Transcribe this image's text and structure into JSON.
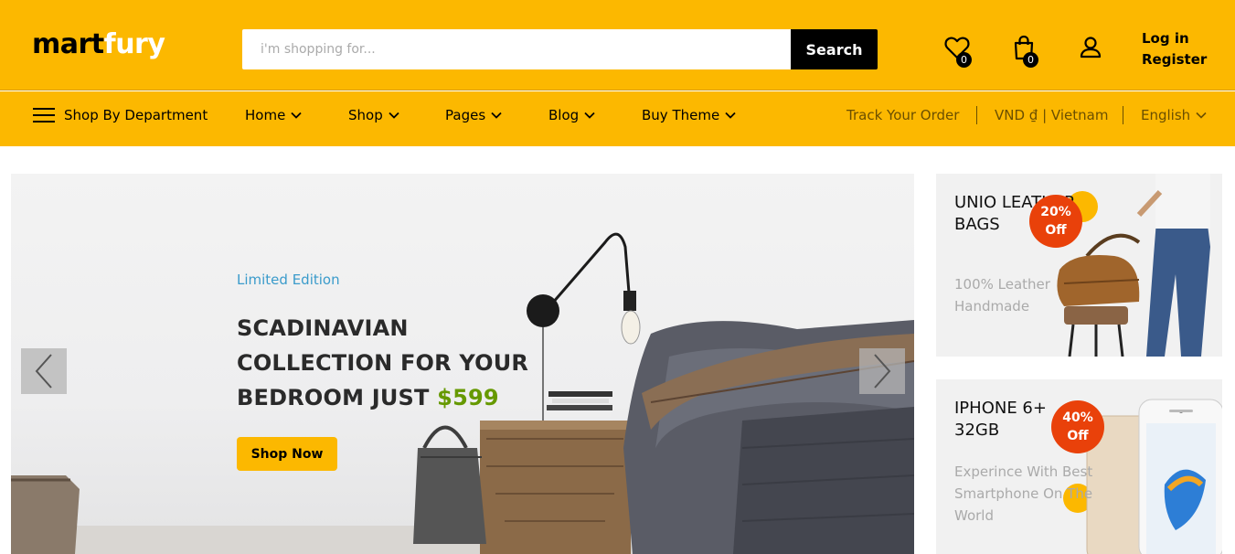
{
  "logo": {
    "part1": "mart",
    "part2": "fury"
  },
  "search": {
    "placeholder": "i'm shopping for...",
    "button_label": "Search"
  },
  "header_icons": {
    "wishlist_count": "0",
    "cart_count": "0"
  },
  "auth": {
    "login": "Log in",
    "register": "Register"
  },
  "nav": {
    "department": "Shop By Department",
    "items": [
      {
        "label": "Home"
      },
      {
        "label": "Shop"
      },
      {
        "label": "Pages"
      },
      {
        "label": "Blog"
      },
      {
        "label": "Buy Theme"
      }
    ],
    "track_order": "Track Your Order",
    "currency": "VND ₫ | Vietnam",
    "language": "English"
  },
  "hero": {
    "label": "Limited Edition",
    "title_line1": "SCADINAVIAN",
    "title_line2": "COLLECTION FOR YOUR",
    "title_line3": "BEDROOM JUST",
    "price": "$599",
    "button": "Shop Now"
  },
  "promos": [
    {
      "title": "UNIO LEATHER BAGS",
      "subtitle": "100% Leather Handmade",
      "discount_value": "20%",
      "discount_label": "Off"
    },
    {
      "title": "IPHONE 6+ 32GB",
      "subtitle": "Experince With Best Smartphone On The World",
      "discount_value": "40%",
      "discount_label": "Off"
    }
  ],
  "colors": {
    "brand_yellow": "#fcb800",
    "price_green": "#669900",
    "label_blue": "#3a9bcb",
    "discount_red": "#e9410a"
  },
  "icons": [
    "heart-icon",
    "shopping-bag-icon",
    "user-icon",
    "hamburger-menu-icon",
    "chevron-down-icon",
    "arrow-left-icon",
    "arrow-right-icon"
  ]
}
